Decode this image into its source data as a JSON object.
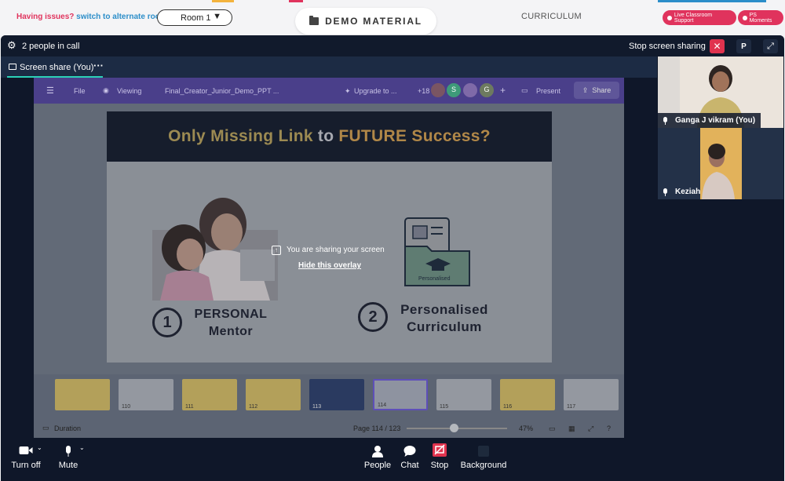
{
  "topbar": {
    "issue_prefix": "Having issues?",
    "issue_link": "switch to alternate room",
    "room_select": "Room 1",
    "demo_tab": "DEMO MATERIAL",
    "curriculum_tab": "CURRICULUM",
    "support_pill": "Live Classroom Support",
    "moments_pill": "PS Moments",
    "colors": {
      "accent_red": "#e0335d",
      "link_blue": "#2c8ec9"
    }
  },
  "call": {
    "people_count": "2 people in call",
    "stop_sharing": "Stop screen sharing",
    "p_button": "P",
    "share_tab": "Screen share (You)",
    "share_tab_menu": "···"
  },
  "shared_screen": {
    "canva": {
      "file": "File",
      "viewing": "Viewing",
      "doc_name": "Final_Creator_Junior_Demo_PPT ...",
      "upgrade": "Upgrade to ...",
      "collab_count": "+18",
      "avatars": [
        "S",
        "G"
      ],
      "plus": "+",
      "present": "Present",
      "share": "Share"
    },
    "slide": {
      "title_part1": "Only Missing Link",
      "title_part2": "to",
      "title_part3": "FUTURE Success?",
      "item1_number": "1",
      "item1_line1": "PERSONAL",
      "item1_line2": "Mentor",
      "item2_number": "2",
      "item2_line1": "Personalised",
      "item2_line2": "Curriculum",
      "folder_label": "Personalised"
    },
    "overlay": {
      "message": "You are sharing your screen",
      "hide_link": "Hide this overlay"
    },
    "thumbnails": [
      "110",
      "111",
      "112",
      "113",
      "114",
      "115",
      "116",
      "117"
    ],
    "selected_page": "114",
    "status": {
      "duration": "Duration",
      "page": "Page 114 / 123",
      "zoom": "47%",
      "zoom_fraction": 0.47
    }
  },
  "participants": [
    {
      "name": "Ganga J vikram (You)"
    },
    {
      "name": "Keziah"
    }
  ],
  "controls": {
    "camera": "Turn off",
    "mute": "Mute",
    "people": "People",
    "chat": "Chat",
    "stop": "Stop",
    "background": "Background"
  }
}
